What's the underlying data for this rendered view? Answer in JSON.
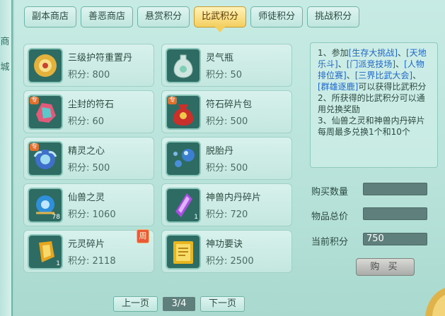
{
  "side": {
    "chars": [
      "商",
      "城"
    ]
  },
  "tabs": [
    {
      "label": "副本商店"
    },
    {
      "label": "善恶商店"
    },
    {
      "label": "悬赏积分"
    },
    {
      "label": "比武积分",
      "active": true
    },
    {
      "label": "师徒积分"
    },
    {
      "label": "挑战积分"
    }
  ],
  "items": [
    {
      "name": "三级护符重置丹",
      "cost": "积分: 800",
      "icon": "amulet-reset-pill-icon"
    },
    {
      "name": "灵气瓶",
      "cost": "积分: 50",
      "icon": "spirit-vase-icon"
    },
    {
      "name": "尘封的符石",
      "cost": "积分: 60",
      "icon": "sealed-rune-stone-icon",
      "tag": "专"
    },
    {
      "name": "符石碎片包",
      "cost": "积分: 500",
      "icon": "rune-fragment-bag-icon",
      "tag": "专"
    },
    {
      "name": "精灵之心",
      "cost": "积分: 500",
      "icon": "elf-heart-icon",
      "tag": "专"
    },
    {
      "name": "脱胎丹",
      "cost": "积分: 500",
      "icon": "rebirth-pill-icon"
    },
    {
      "name": "仙兽之灵",
      "cost": "积分: 1060",
      "icon": "immortal-beast-spirit-icon",
      "count": "78"
    },
    {
      "name": "神兽内丹碎片",
      "cost": "积分: 720",
      "icon": "divine-beast-core-shard-icon",
      "count": "1"
    },
    {
      "name": "元灵碎片",
      "cost": "积分: 2118",
      "icon": "yuanling-shard-icon",
      "count": "1",
      "week": "周"
    },
    {
      "name": "神功要诀",
      "cost": "积分: 2500",
      "icon": "divine-skill-book-icon"
    }
  ],
  "info": {
    "p1_pre": "1、参加",
    "links": [
      "[生存大挑战]",
      "[天地乐斗]",
      "[门派竞技场]",
      "[人物排位赛]",
      "[三界比武大会]",
      "[群雄逐鹿]"
    ],
    "p1_post": "可以获得比武积分",
    "p2": "2、所获得的比武积分可以通用兑换奖励",
    "p3": "3、仙兽之灵和神兽内丹碎片每周最多兑换1个和10个"
  },
  "form": {
    "qty_label": "购买数量",
    "qty_value": "",
    "total_label": "物品总价",
    "total_value": "",
    "current_label": "当前积分",
    "current_value": "750",
    "buy_label": "购 买"
  },
  "pager": {
    "prev": "上一页",
    "page": "3/4",
    "next": "下一页"
  },
  "colors": {
    "accent": "#f4cf5f",
    "link": "#1f66c5",
    "bg": "#b7e2da"
  }
}
